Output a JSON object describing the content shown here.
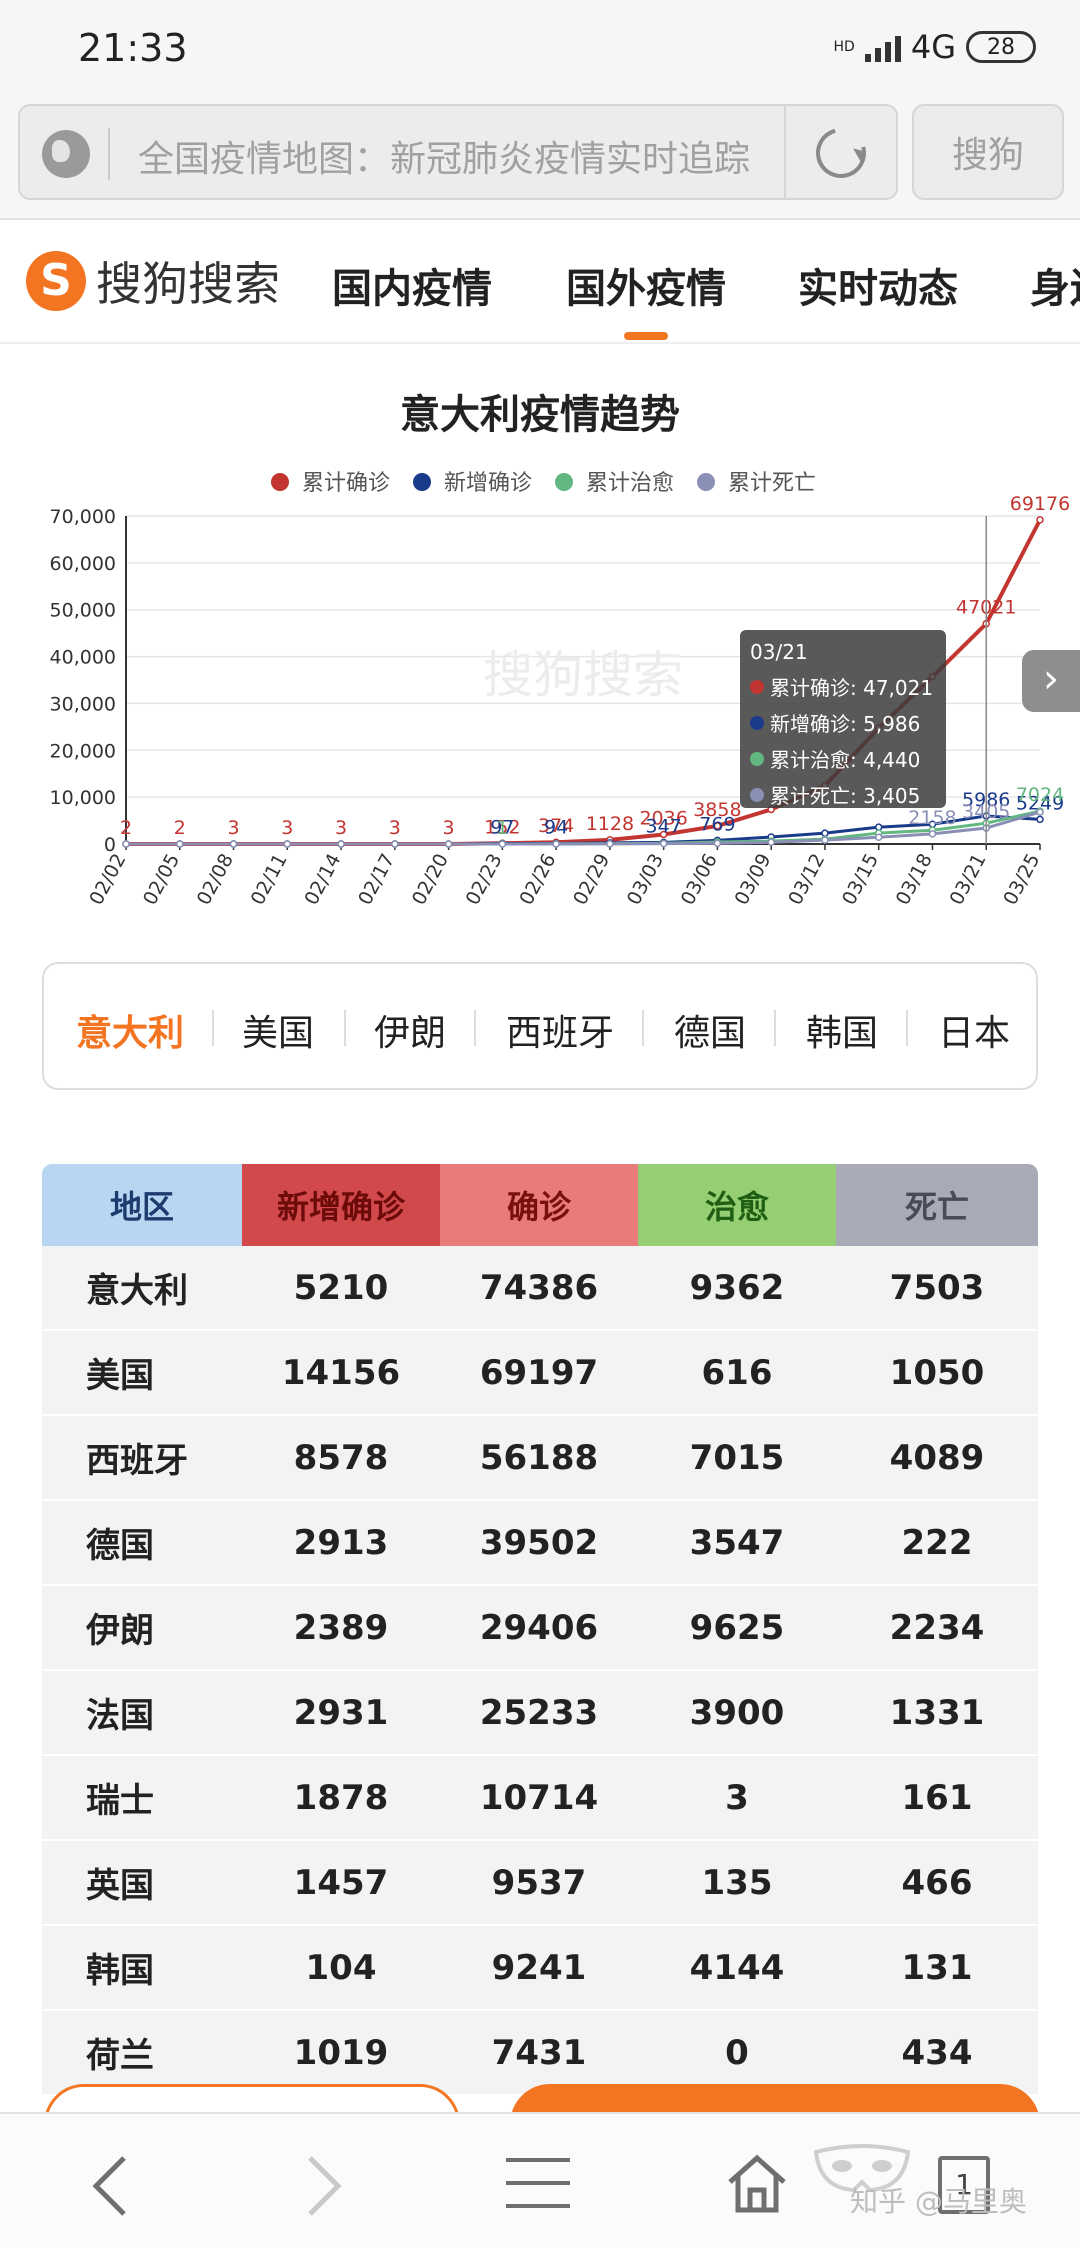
{
  "status_bar": {
    "time": "21:33",
    "network": "4G",
    "signal_prefix": "HD",
    "battery": "28"
  },
  "browser": {
    "url_text": "全国疫情地图：新冠肺炎疫情实时追踪",
    "search_button": "搜狗"
  },
  "site_nav": {
    "logo_text": "搜狗搜索",
    "items": [
      "国内疫情",
      "国外疫情",
      "实时动态",
      "身边"
    ],
    "active_index": 1,
    "accent": "#f37421"
  },
  "chart": {
    "title": "意大利疫情趋势",
    "next_icon": "chevron-right-icon",
    "tooltip": {
      "date": "03/21",
      "rows": [
        {
          "label": "累计确诊: 47,021",
          "color": "#c23531"
        },
        {
          "label": "新增确诊: 5,986",
          "color": "#1a3a8a"
        },
        {
          "label": "累计治愈: 4,440",
          "color": "#61b77f"
        },
        {
          "label": "累计死亡: 3,405",
          "color": "#8a8fb5"
        }
      ]
    }
  },
  "chart_data": {
    "type": "line",
    "title": "意大利疫情趋势",
    "watermark": "搜狗搜索",
    "x": [
      "02/02",
      "02/05",
      "02/08",
      "02/11",
      "02/14",
      "02/17",
      "02/20",
      "02/23",
      "02/26",
      "02/29",
      "03/03",
      "03/06",
      "03/09",
      "03/12",
      "03/15",
      "03/18",
      "03/21",
      "03/25"
    ],
    "ylim": [
      0,
      70000
    ],
    "yticks": [
      "0",
      "10,000",
      "20,000",
      "30,000",
      "40,000",
      "50,000",
      "60,000",
      "70,000"
    ],
    "grid": true,
    "legend_position": "top",
    "series": [
      {
        "name": "累计确诊",
        "color": "#c23531",
        "values": [
          2,
          2,
          3,
          3,
          3,
          3,
          3,
          152,
          374,
          889,
          2036,
          3858,
          7375,
          12462,
          24747,
          35713,
          47021,
          69176
        ],
        "labels": [
          "2",
          "2",
          "3",
          "3",
          "3",
          "3",
          "3",
          "152",
          "374",
          "1128",
          "2036",
          "3858",
          "",
          "",
          "",
          "",
          "47021",
          "69176"
        ]
      },
      {
        "name": "新增确诊",
        "color": "#1a3a8a",
        "values": [
          0,
          0,
          0,
          0,
          0,
          0,
          0,
          97,
          94,
          240,
          347,
          769,
          1492,
          2313,
          3590,
          4207,
          5986,
          5249
        ],
        "labels": [
          "",
          "",
          "",
          "",
          "",
          "",
          "",
          "97",
          "94",
          "",
          "347",
          "769",
          "",
          "",
          "",
          "",
          "5986",
          "5249"
        ]
      },
      {
        "name": "累计治愈",
        "color": "#61b77f",
        "values": [
          0,
          0,
          0,
          0,
          0,
          0,
          0,
          1,
          45,
          46,
          160,
          414,
          622,
          1045,
          2335,
          2941,
          4440,
          7024
        ],
        "labels": [
          "",
          "",
          "",
          "",
          "",
          "",
          "",
          "1",
          "",
          "",
          "",
          "",
          "",
          "",
          "",
          "",
          "",
          "7024"
        ]
      },
      {
        "name": "累计死亡",
        "color": "#8a8fb5",
        "values": [
          0,
          0,
          0,
          0,
          0,
          0,
          0,
          3,
          12,
          29,
          79,
          148,
          366,
          827,
          1441,
          2158,
          3405,
          6820
        ],
        "labels": [
          "",
          "",
          "",
          "",
          "",
          "",
          "",
          "",
          "",
          "",
          "",
          "",
          "",
          "",
          "",
          "2158",
          "3405",
          ""
        ]
      }
    ]
  },
  "country_tabs": {
    "items": [
      "意大利",
      "美国",
      "伊朗",
      "西班牙",
      "德国",
      "韩国",
      "日本"
    ],
    "active_index": 0
  },
  "table": {
    "headers": [
      "地区",
      "新增确诊",
      "确诊",
      "治愈",
      "死亡"
    ],
    "header_colors": [
      "#b8d6f1",
      "#d2494c",
      "#ea7b7b",
      "#96cf73",
      "#a9aab8"
    ],
    "header_text_colors": [
      "#1d3b6d",
      "#6d0b0b",
      "#7a0f10",
      "#1f5f14",
      "#4a4a56"
    ],
    "rows": [
      [
        "意大利",
        "5210",
        "74386",
        "9362",
        "7503"
      ],
      [
        "美国",
        "14156",
        "69197",
        "616",
        "1050"
      ],
      [
        "西班牙",
        "8578",
        "56188",
        "7015",
        "4089"
      ],
      [
        "德国",
        "2913",
        "39502",
        "3547",
        "222"
      ],
      [
        "伊朗",
        "2389",
        "29406",
        "9625",
        "2234"
      ],
      [
        "法国",
        "2931",
        "25233",
        "3900",
        "1331"
      ],
      [
        "瑞士",
        "1878",
        "10714",
        "3",
        "161"
      ],
      [
        "英国",
        "1457",
        "9537",
        "135",
        "466"
      ],
      [
        "韩国",
        "104",
        "9241",
        "4144",
        "131"
      ],
      [
        "荷兰",
        "1019",
        "7431",
        "0",
        "434"
      ]
    ]
  },
  "bottom_nav": {
    "back_icon": "back-arrow-icon",
    "forward_icon": "forward-arrow-icon",
    "menu_icon": "menu-icon",
    "home_icon": "home-icon",
    "tabs_count": "1",
    "watermark": "知乎 @马里奥"
  }
}
